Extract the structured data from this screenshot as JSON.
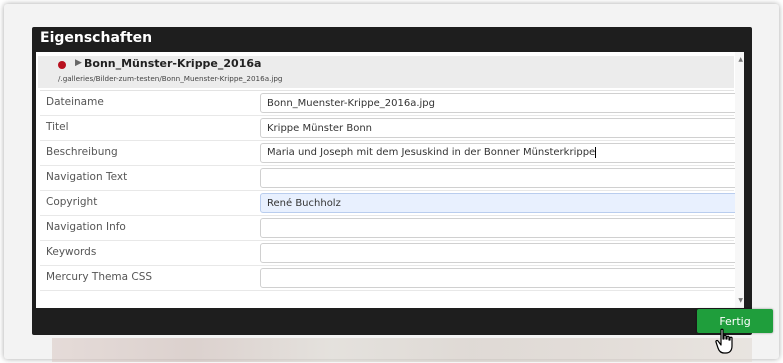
{
  "dialog": {
    "title": "Eigenschaften",
    "resource_name": "Bonn_Münster-Krippe_2016a",
    "resource_path": "/.galleries/Bilder-zum-testen/Bonn_Muenster-Krippe_2016a.jpg"
  },
  "fields": [
    {
      "label": "Dateiname",
      "value": "Bonn_Muenster-Krippe_2016a.jpg"
    },
    {
      "label": "Titel",
      "value": "Krippe Münster Bonn"
    },
    {
      "label": "Beschreibung",
      "value": "Maria und Joseph mit dem Jesuskind in der Bonner Münsterkrippe"
    },
    {
      "label": "Navigation Text",
      "value": ""
    },
    {
      "label": "Copyright",
      "value": "René Buchholz"
    },
    {
      "label": "Navigation Info",
      "value": ""
    },
    {
      "label": "Keywords",
      "value": ""
    },
    {
      "label": "Mercury Thema CSS",
      "value": ""
    }
  ],
  "footer": {
    "done_label": "Fertig"
  },
  "colors": {
    "accent": "#1f9e3c",
    "status_dot": "#b8111f",
    "dialog_bg": "#1e1e1e"
  }
}
